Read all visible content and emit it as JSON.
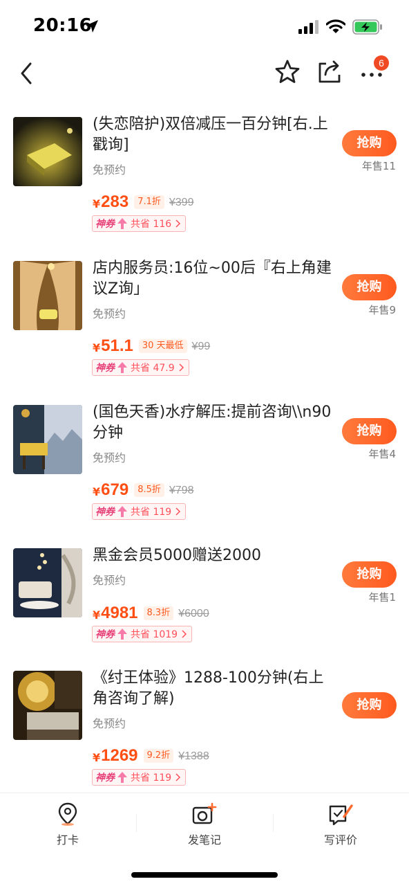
{
  "status_bar": {
    "time": "20:16"
  },
  "nav": {
    "more_badge": "6",
    "icons": [
      "back-icon",
      "star-icon",
      "share-icon",
      "more-icon"
    ]
  },
  "deals": [
    {
      "title": "(失恋陪护)双倍减压一百分钟[右.上戳询]",
      "booking": "免预约",
      "price": "283",
      "discount": "7.1折",
      "original": "¥399",
      "coupon_brand": "神券",
      "coupon_saving": "共省 116",
      "buy_label": "抢购",
      "sales": "年售11"
    },
    {
      "title": "店内服务员:16位~00后『右上角建议Z询」",
      "booking": "免预约",
      "price": "51.1",
      "discount": "30 天最低",
      "original": "¥99",
      "coupon_brand": "神券",
      "coupon_saving": "共省 47.9",
      "buy_label": "抢购",
      "sales": "年售9"
    },
    {
      "title": "(国色天香)水疗解压:提前咨询\\\\n90分钟",
      "booking": "免预约",
      "price": "679",
      "discount": "8.5折",
      "original": "¥798",
      "coupon_brand": "神券",
      "coupon_saving": "共省 119",
      "buy_label": "抢购",
      "sales": "年售4"
    },
    {
      "title": "黑金会员5000赠送2000",
      "booking": "免预约",
      "price": "4981",
      "discount": "8.3折",
      "original": "¥6000",
      "coupon_brand": "神券",
      "coupon_saving": "共省 1019",
      "buy_label": "抢购",
      "sales": "年售1"
    },
    {
      "title": "《纣王体验》1288-100分钟(右上角咨询了解)",
      "booking": "免预约",
      "price": "1269",
      "discount": "9.2折",
      "original": "¥1388",
      "coupon_brand": "神券",
      "coupon_saving": "共省 119",
      "buy_label": "抢购",
      "sales": ""
    }
  ],
  "currency_symbol": "¥",
  "bottom_tabs": [
    {
      "label": "打卡",
      "icon": "location-pin-icon"
    },
    {
      "label": "发笔记",
      "icon": "camera-plus-icon"
    },
    {
      "label": "写评价",
      "icon": "edit-review-icon"
    }
  ],
  "colors": {
    "accent": "#ff5a1f",
    "price": "#ff4f14",
    "badge": "#f04a24"
  }
}
